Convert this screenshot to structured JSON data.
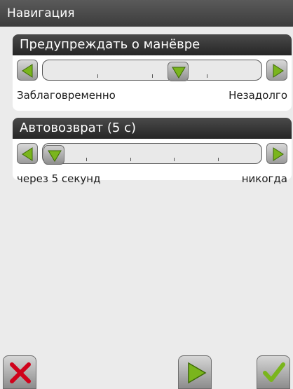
{
  "window": {
    "title": "Навигация"
  },
  "settings": [
    {
      "header": "Предупреждать о манёвре",
      "left_label": "Заблаговременно",
      "right_label": "Незадолго",
      "level_percent": 62
    },
    {
      "header": "Автовозврат (5 с)",
      "left_label": "через 5 секунд",
      "right_label": "никогда",
      "level_percent": 5
    }
  ],
  "colors": {
    "accent_green": "#7ab51d",
    "cancel_red": "#d0021b"
  },
  "icons": {
    "left": "triangle-left-icon",
    "right": "triangle-right-icon",
    "thumb": "triangle-down-icon",
    "cancel": "x-icon",
    "next": "play-icon",
    "confirm": "checkmark-icon"
  }
}
